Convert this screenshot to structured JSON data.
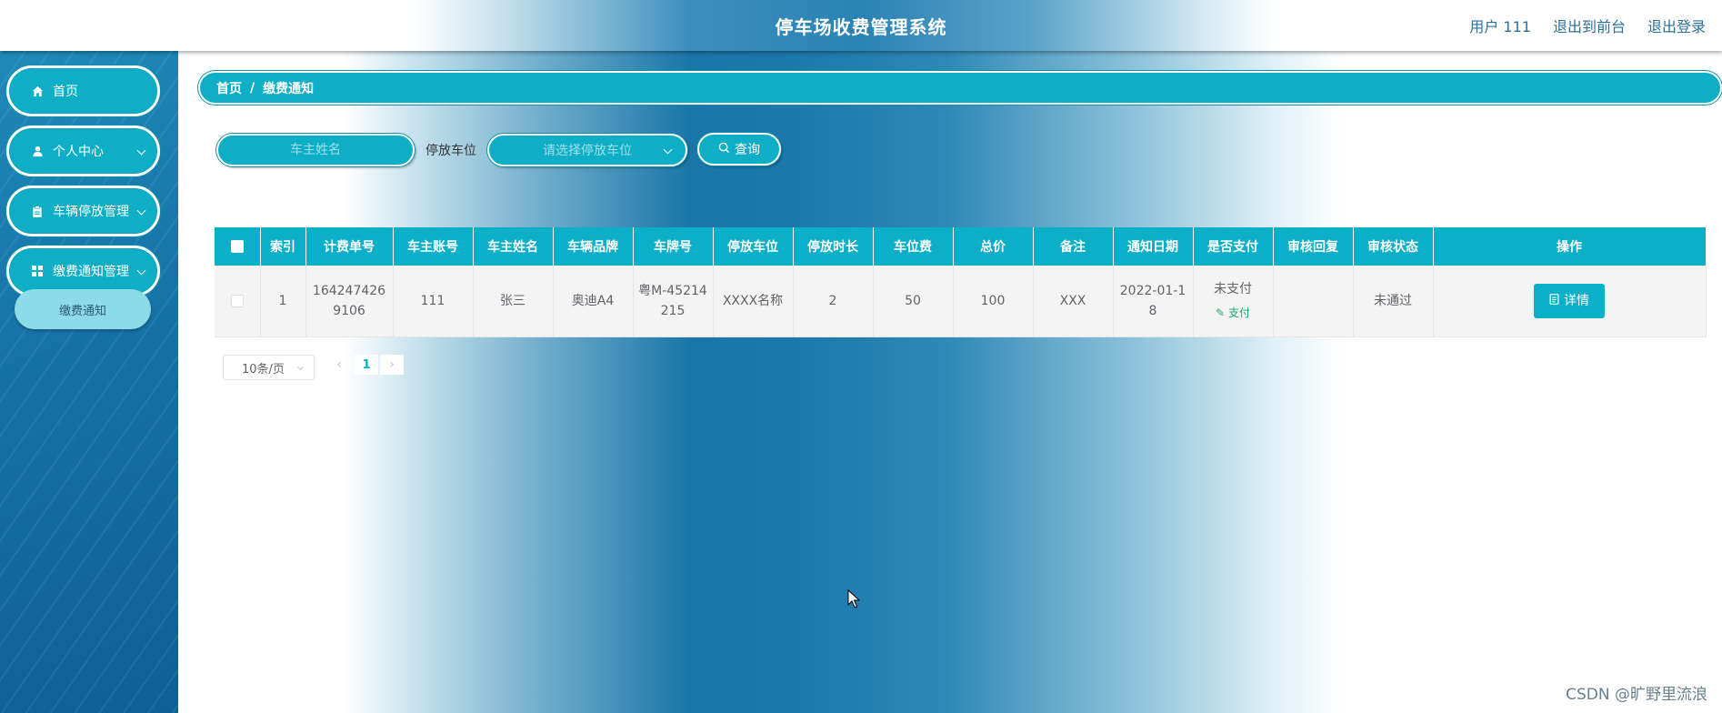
{
  "header": {
    "title": "停车场收费管理系统",
    "links": [
      "用户 111",
      "退出到前台",
      "退出登录"
    ]
  },
  "sidebar": {
    "items": [
      {
        "label": "首页",
        "icon": "home-icon",
        "expandable": false
      },
      {
        "label": "个人中心",
        "icon": "user-icon",
        "expandable": true
      },
      {
        "label": "车辆停放管理",
        "icon": "clipboard-icon",
        "expandable": true
      },
      {
        "label": "缴费通知管理",
        "icon": "grid-icon",
        "expandable": true
      }
    ],
    "submenu_item": "缴费通知"
  },
  "breadcrumb": {
    "home": "首页",
    "current": "缴费通知"
  },
  "search": {
    "owner_name_placeholder": "车主姓名",
    "parking_label": "停放车位",
    "parking_placeholder": "请选择停放车位",
    "query_label": "查询"
  },
  "table": {
    "columns": [
      "索引",
      "计费单号",
      "车主账号",
      "车主姓名",
      "车辆品牌",
      "车牌号",
      "停放车位",
      "停放时长",
      "车位费",
      "总价",
      "备注",
      "通知日期",
      "是否支付",
      "审核回复",
      "审核状态",
      "操作"
    ],
    "rows": [
      {
        "index": "1",
        "bill_no": "1642474269106",
        "owner_account": "111",
        "owner_name": "张三",
        "brand": "奥迪A4",
        "plate": "粤M-45214215",
        "parking_space": "XXXX名称",
        "duration": "2",
        "space_fee": "50",
        "total": "100",
        "remark": "XXX",
        "notice_date": "2022-01-18",
        "paid_status": "未支付",
        "pay_action": "支付",
        "review_reply": "",
        "review_status": "未通过",
        "detail_label": "详情"
      }
    ]
  },
  "pagination": {
    "page_size": "10条/页",
    "current_page": "1"
  },
  "watermark": "CSDN @旷野里流浪",
  "colors": {
    "accent": "#0bafc8",
    "sidebar": "#1671a6",
    "pay_green": "#13a86b"
  }
}
